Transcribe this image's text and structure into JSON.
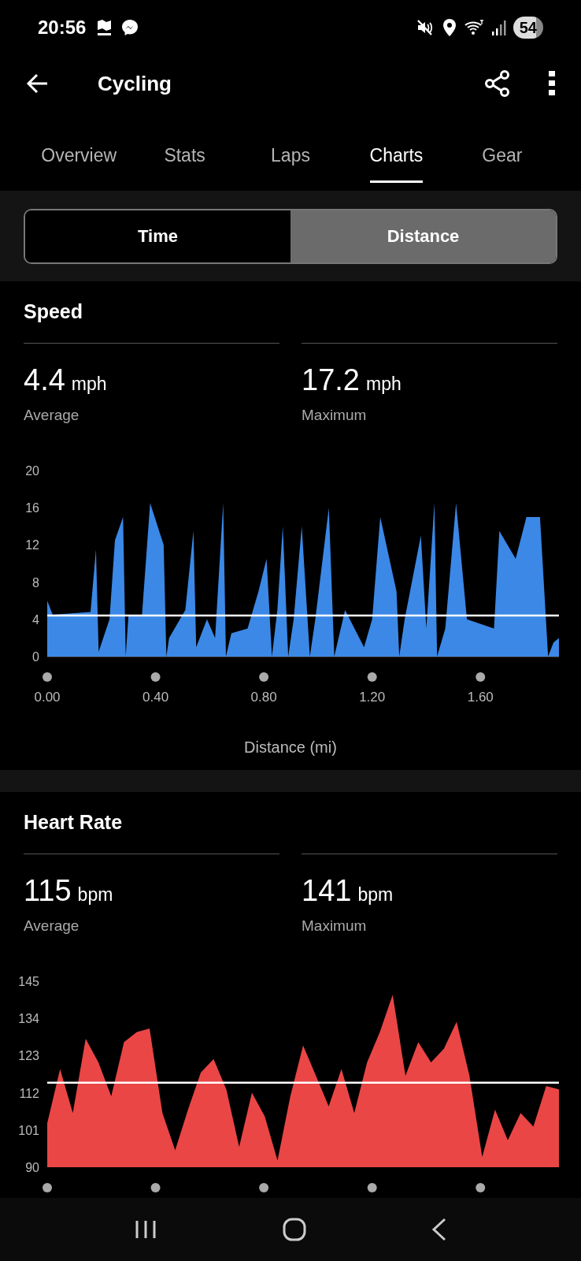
{
  "status_bar": {
    "time": "20:56",
    "battery": "54"
  },
  "header": {
    "title": "Cycling"
  },
  "tabs": [
    {
      "label": "Overview",
      "selected": false
    },
    {
      "label": "Stats",
      "selected": false
    },
    {
      "label": "Laps",
      "selected": false
    },
    {
      "label": "Charts",
      "selected": true
    },
    {
      "label": "Gear",
      "selected": false
    }
  ],
  "toggle": [
    {
      "label": "Time",
      "selected": false
    },
    {
      "label": "Distance",
      "selected": true
    }
  ],
  "sections": [
    {
      "title": "Speed",
      "stats": [
        {
          "value": "4.4",
          "unit": "mph",
          "label": "Average"
        },
        {
          "value": "17.2",
          "unit": "mph",
          "label": "Maximum"
        }
      ],
      "chart_data": {
        "type": "area",
        "xlabel": "Distance (mi)",
        "xlim": [
          0,
          1.89
        ],
        "yticks": [
          0,
          4,
          8,
          12,
          16,
          20
        ],
        "xticks": [
          {
            "value": 0,
            "label": "0.00"
          },
          {
            "value": 0.4,
            "label": "0.40"
          },
          {
            "value": 0.8,
            "label": "0.80"
          },
          {
            "value": 1.2,
            "label": "1.20"
          },
          {
            "value": 1.6,
            "label": "1.60"
          }
        ],
        "x": [
          0,
          0.02,
          0.16,
          0.18,
          0.19,
          0.23,
          0.25,
          0.28,
          0.29,
          0.3,
          0.35,
          0.38,
          0.43,
          0.44,
          0.45,
          0.51,
          0.54,
          0.55,
          0.59,
          0.62,
          0.65,
          0.66,
          0.68,
          0.74,
          0.78,
          0.81,
          0.83,
          0.85,
          0.87,
          0.89,
          0.91,
          0.94,
          0.97,
          0.99,
          1.04,
          1.06,
          1.1,
          1.17,
          1.2,
          1.23,
          1.29,
          1.3,
          1.32,
          1.38,
          1.4,
          1.43,
          1.44,
          1.47,
          1.51,
          1.55,
          1.65,
          1.67,
          1.73,
          1.77,
          1.82,
          1.85,
          1.87,
          1.89
        ],
        "series": [
          {
            "color": "#3b88e6",
            "values": [
              6,
              4.5,
              4.8,
              11.5,
              0.5,
              4,
              12.5,
              15,
              0,
              4.5,
              4.5,
              16.5,
              12,
              0,
              2,
              5,
              13.5,
              1,
              4,
              2,
              16.5,
              0,
              2.5,
              3,
              7,
              10.5,
              0,
              5,
              14,
              0,
              4,
              14,
              0,
              4,
              16,
              0,
              5,
              1,
              4,
              15,
              7,
              0,
              4,
              13,
              3,
              16.5,
              0,
              3,
              16.5,
              4,
              3,
              13.5,
              10.5,
              15,
              15,
              0,
              1.5,
              2
            ]
          },
          {
            "type": "line",
            "color": "#ffffff",
            "values": [
              4.4,
              4.4,
              4.4,
              4.4,
              4.4,
              4.4,
              4.4,
              4.4,
              4.4,
              4.4,
              4.4,
              4.4,
              4.4,
              4.4,
              4.4,
              4.4,
              4.4,
              4.4,
              4.4,
              4.4,
              4.4,
              4.4,
              4.4,
              4.4,
              4.4,
              4.4,
              4.4,
              4.4,
              4.4,
              4.4,
              4.4,
              4.4,
              4.4,
              4.4,
              4.4,
              4.4,
              4.4,
              4.4,
              4.4,
              4.4,
              4.4,
              4.4,
              4.4,
              4.4,
              4.4,
              4.4,
              4.4,
              4.4,
              4.4,
              4.4,
              4.4,
              4.4,
              4.4,
              4.4,
              4.4,
              4.4,
              4.4,
              4.4
            ]
          }
        ],
        "ylim": [
          0,
          20
        ]
      }
    },
    {
      "title": "Heart Rate",
      "stats": [
        {
          "value": "115",
          "unit": "bpm",
          "label": "Average"
        },
        {
          "value": "141",
          "unit": "bpm",
          "label": "Maximum"
        }
      ],
      "chart_data": {
        "type": "area",
        "yticks": [
          90,
          101,
          112,
          123,
          134,
          145
        ],
        "series": [
          {
            "color": "#ea4646",
            "values": [
              103,
              119,
              106,
              128,
              121,
              111,
              127,
              130,
              131,
              106,
              95,
              107,
              118,
              122,
              113,
              96,
              112,
              105,
              92,
              111,
              126,
              117,
              108,
              119,
              106,
              121,
              130,
              141,
              117,
              127,
              121,
              125,
              133,
              117,
              93,
              107,
              98,
              106,
              102,
              114,
              113
            ]
          },
          {
            "type": "line",
            "color": "#ffffff",
            "values": [
              115,
              115,
              115,
              115,
              115,
              115,
              115,
              115,
              115,
              115,
              115,
              115,
              115,
              115,
              115,
              115,
              115,
              115,
              115,
              115,
              115,
              115,
              115,
              115,
              115,
              115,
              115,
              115,
              115,
              115,
              115,
              115,
              115,
              115,
              115,
              115,
              115,
              115,
              115,
              115,
              115
            ]
          }
        ],
        "ylim": [
          90,
          145
        ]
      }
    }
  ]
}
